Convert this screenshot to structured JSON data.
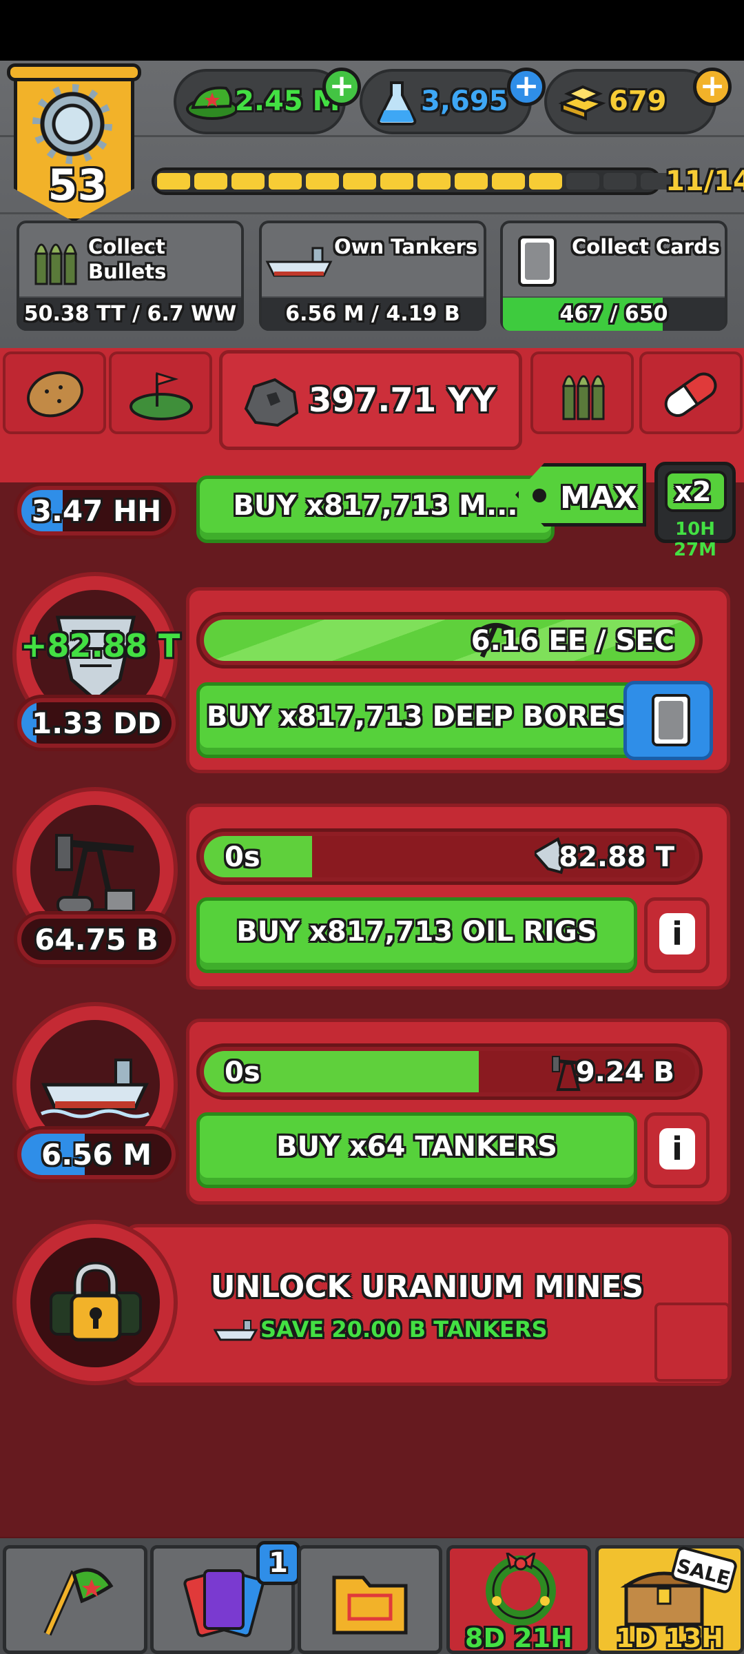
{
  "player": {
    "level": "53"
  },
  "currencies": {
    "cash": {
      "value": "2.45 M",
      "color": "#43e043",
      "icon": "army-cap-icon"
    },
    "science": {
      "value": "3,695",
      "color": "#3ea7f5",
      "icon": "flask-icon"
    },
    "gold": {
      "value": "679",
      "color": "#f7cc35",
      "icon": "gold-bars-icon"
    }
  },
  "xp": {
    "label": "11/14",
    "filled": 11,
    "total": 14
  },
  "quests": [
    {
      "label_line1": "Collect",
      "label_line2": "Bullets",
      "progress": "50.38 TT / 6.7 WW",
      "fraction": 0.0,
      "icon": "bullets-icon"
    },
    {
      "label_line1": "Own Tankers",
      "label_line2": "",
      "progress": "6.56 M / 4.19 B",
      "fraction": 0.0,
      "icon": "tanker-icon"
    },
    {
      "label_line1": "Collect Cards",
      "label_line2": "",
      "progress": "467 / 650",
      "fraction": 0.72,
      "icon": "card-icon"
    }
  ],
  "resource_tabs": {
    "active_value": "397.71 YY",
    "tabs": [
      "potato-icon",
      "land-flag-icon",
      "ore-icon",
      "bullets-icon",
      "pill-icon"
    ]
  },
  "top_row": {
    "count": "3.47 HH",
    "buy_label": "BUY x817,713 M...",
    "max_label": "MAX",
    "boost_label": "x2",
    "boost_timer": "10H 27M"
  },
  "deep_bores": {
    "floating": "+82.88 T",
    "count": "1.33 DD",
    "count_fraction": 0.1,
    "rate": "6.16 EE / SEC",
    "buy_label": "BUY x817,713 DEEP BORES"
  },
  "oil_rigs": {
    "count": "64.75 B",
    "timer": "0s",
    "fraction": 0.22,
    "input": "82.88 T",
    "buy_label": "BUY x817,713 OIL RIGS",
    "info": "i"
  },
  "tankers": {
    "count": "6.56 M",
    "count_fraction": 0.42,
    "timer": "0s",
    "fraction": 0.56,
    "input": "9.24 B",
    "buy_label": "BUY x64 TANKERS",
    "info": "i"
  },
  "unlock": {
    "title": "UNLOCK URANIUM MINES",
    "subtitle": "SAVE 20.00 B TANKERS"
  },
  "bottom_nav": {
    "cards_badge": "1",
    "event_timer": "8D 21H",
    "sale_timer": "1D 13H",
    "sale_label": "SALE"
  }
}
